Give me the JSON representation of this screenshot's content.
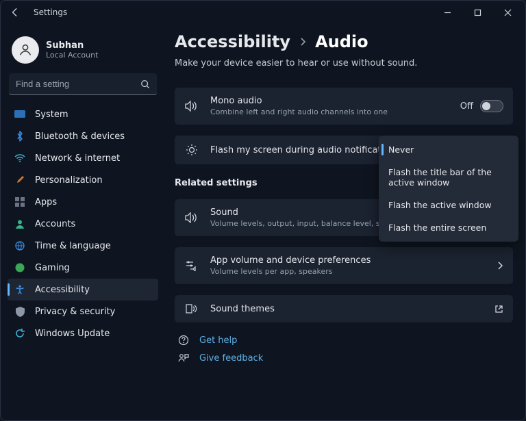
{
  "window": {
    "title": "Settings"
  },
  "user": {
    "name": "Subhan",
    "account_type": "Local Account"
  },
  "search": {
    "placeholder": "Find a setting"
  },
  "sidebar": {
    "items": [
      {
        "label": "System"
      },
      {
        "label": "Bluetooth & devices"
      },
      {
        "label": "Network & internet"
      },
      {
        "label": "Personalization"
      },
      {
        "label": "Apps"
      },
      {
        "label": "Accounts"
      },
      {
        "label": "Time & language"
      },
      {
        "label": "Gaming"
      },
      {
        "label": "Accessibility"
      },
      {
        "label": "Privacy & security"
      },
      {
        "label": "Windows Update"
      }
    ],
    "selected_index": 8
  },
  "breadcrumb": {
    "parent": "Accessibility",
    "current": "Audio"
  },
  "subtitle": "Make your device easier to hear or use without sound.",
  "mono_audio": {
    "title": "Mono audio",
    "sub": "Combine left and right audio channels into one",
    "state_label": "Off",
    "state": false
  },
  "flash": {
    "title": "Flash my screen during audio notifications",
    "selected": "Never",
    "options": [
      "Never",
      "Flash the title bar of the active window",
      "Flash the active window",
      "Flash the entire screen"
    ]
  },
  "related": {
    "heading": "Related settings",
    "sound": {
      "title": "Sound",
      "sub": "Volume levels, output, input, balance level, sound devices"
    },
    "appvol": {
      "title": "App volume and device preferences",
      "sub": "Volume levels per app, speakers"
    },
    "themes": {
      "title": "Sound themes"
    }
  },
  "links": {
    "help": "Get help",
    "feedback": "Give feedback"
  },
  "colors": {
    "accent": "#60b7ff",
    "link": "#5fb0e8"
  }
}
